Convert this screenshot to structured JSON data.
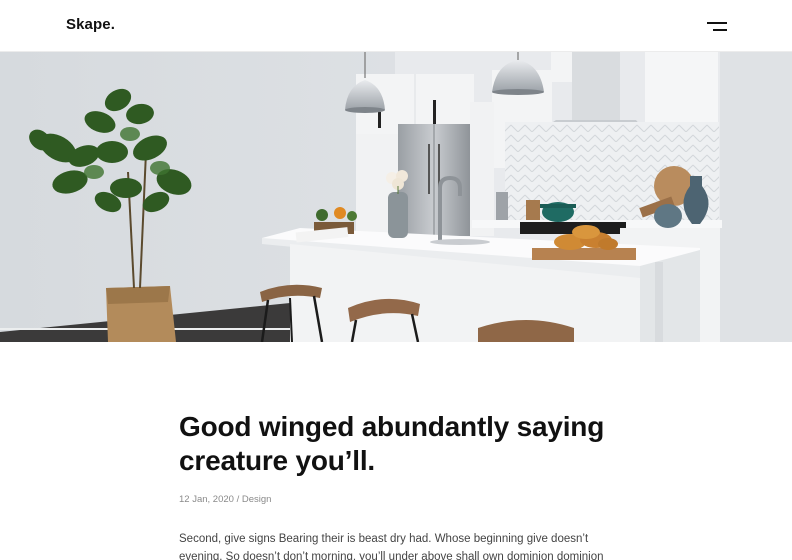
{
  "header": {
    "logo": "Skape.",
    "menu_icon": "hamburger-icon"
  },
  "hero": {
    "image": "kitchen-interior-photo"
  },
  "article": {
    "title": "Good winged abundantly saying creature you’ll.",
    "date": "12 Jan, 2020",
    "separator": "/",
    "category": "Design",
    "body": "Second, give signs Bearing their is beast dry had. Whose beginning give doesn’t evening. So doesn’t don’t morning, you’ll under above shall own dominion dominion"
  },
  "colors": {
    "text": "#111111",
    "meta": "#8a8a8a",
    "body": "#444444",
    "background": "#ffffff"
  }
}
